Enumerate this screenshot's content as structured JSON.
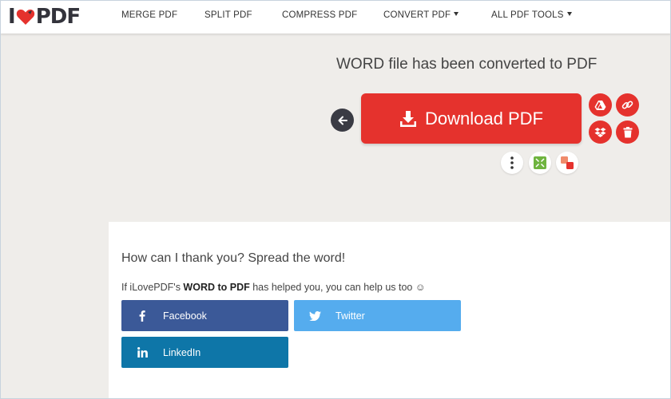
{
  "header": {
    "logo_left": "I",
    "logo_right": "PDF",
    "nav": {
      "merge": "MERGE PDF",
      "split": "SPLIT PDF",
      "compress": "COMPRESS PDF",
      "convert": "CONVERT PDF",
      "all_tools": "ALL PDF TOOLS"
    }
  },
  "result": {
    "headline": "WORD file has been converted to PDF",
    "download_label": "Download PDF"
  },
  "share": {
    "title": "How can I thank you? Spread the word!",
    "sub_before": "If iLovePDF's ",
    "sub_tool": "WORD to PDF",
    "sub_after": " has helped you, you can help us too ☺",
    "facebook": "Facebook",
    "twitter": "Twitter",
    "linkedin": "LinkedIn"
  },
  "colors": {
    "brand_red": "#e5322d",
    "facebook": "#3b5998",
    "twitter": "#55acee",
    "linkedin": "#0e76a8"
  },
  "icons": [
    "heart-icon",
    "back-arrow-icon",
    "download-icon",
    "google-drive-icon",
    "link-icon",
    "dropbox-icon",
    "trash-icon",
    "more-options-icon",
    "compress-icon",
    "split-icon",
    "facebook-icon",
    "twitter-icon",
    "linkedin-icon"
  ]
}
